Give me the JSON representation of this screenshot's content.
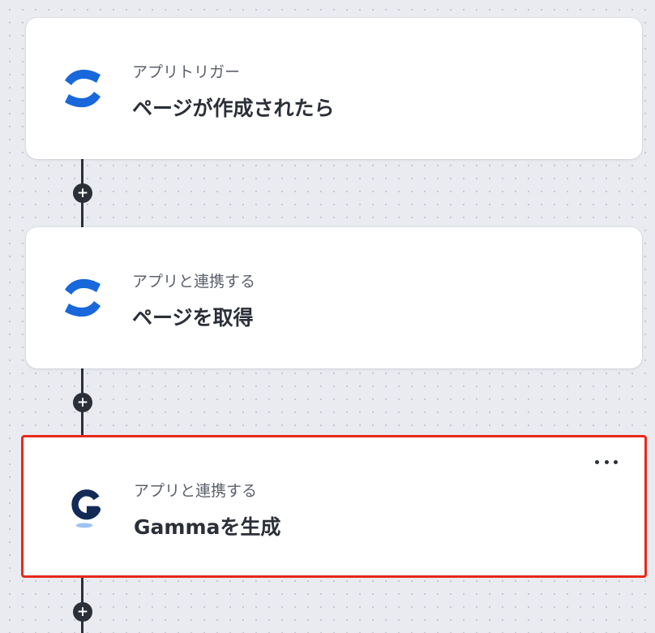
{
  "flow": {
    "steps": [
      {
        "subtitle": "アプリトリガー",
        "title": "ページが作成されたら",
        "app_icon": "confluence-icon"
      },
      {
        "subtitle": "アプリと連携する",
        "title": "ページを取得",
        "app_icon": "confluence-icon"
      },
      {
        "subtitle": "アプリと連携する",
        "title": "Gammaを生成",
        "app_icon": "gamma-icon",
        "selected": true
      }
    ],
    "add_step_symbol": "+"
  },
  "colors": {
    "confluence_blue": "#1868db",
    "gamma_navy": "#132a57",
    "selection_border": "#e8291c",
    "connector": "#2b2f38"
  }
}
